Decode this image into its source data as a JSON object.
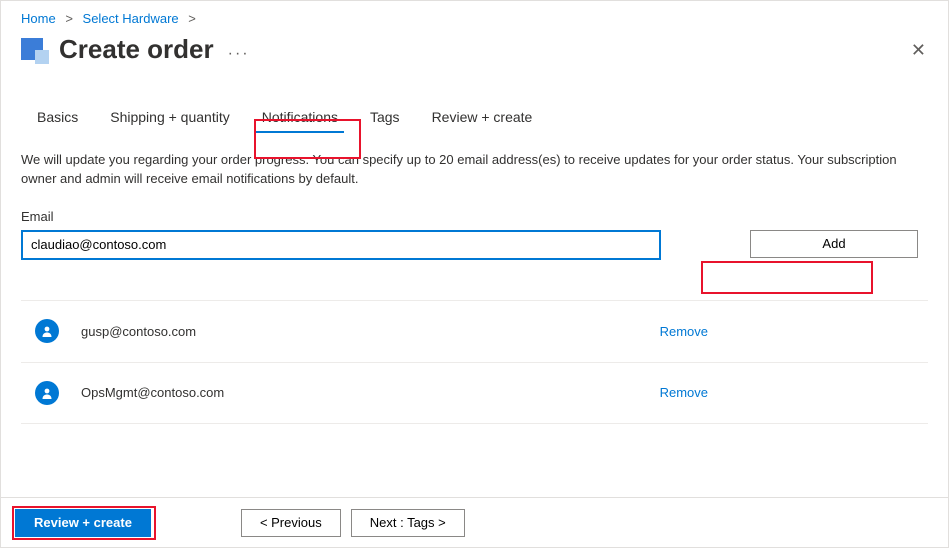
{
  "breadcrumb": {
    "home": "Home",
    "select_hardware": "Select Hardware"
  },
  "page_title": "Create order",
  "tabs": {
    "basics": "Basics",
    "shipping": "Shipping + quantity",
    "notifications": "Notifications",
    "tags": "Tags",
    "review": "Review + create"
  },
  "description": "We will update you regarding your order progress. You can specify up to 20 email address(es) to receive updates for your order status. Your subscription owner and admin will receive email notifications by default.",
  "email": {
    "label": "Email",
    "value": "claudiao@contoso.com",
    "add_label": "Add"
  },
  "email_list": [
    {
      "address": "gusp@contoso.com",
      "remove": "Remove"
    },
    {
      "address": "OpsMgmt@contoso.com",
      "remove": "Remove"
    }
  ],
  "footer": {
    "review_create": "Review + create",
    "previous": "<  Previous",
    "next": "Next : Tags  >"
  }
}
